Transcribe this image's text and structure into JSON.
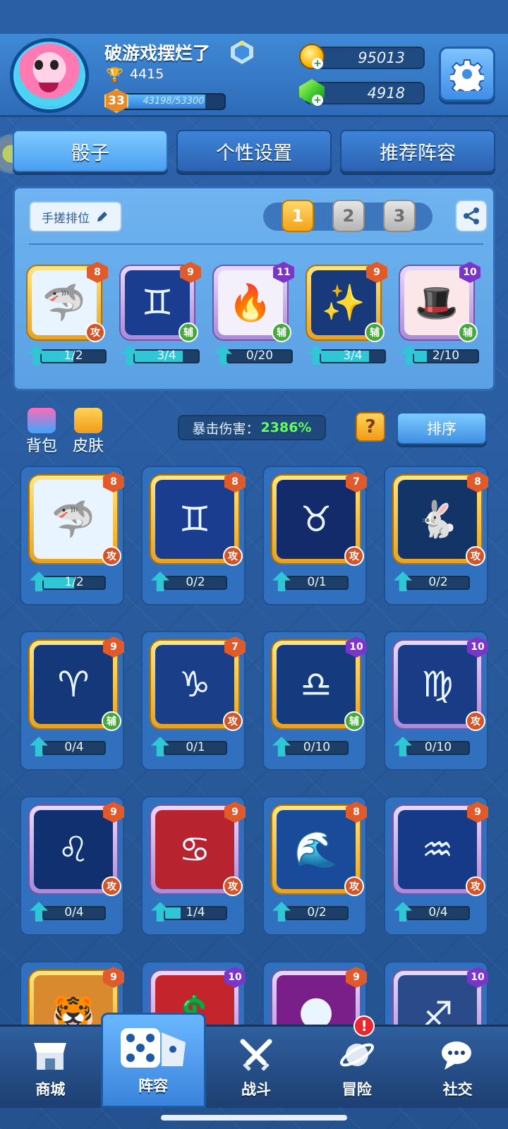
{
  "player": {
    "name": "破游戏摆烂了",
    "trophies": "4415",
    "level": "33",
    "xp": "43198/53300",
    "xp_fraction": 0.81
  },
  "currency": {
    "gold": "95013",
    "gems": "4918"
  },
  "tabs": [
    {
      "label": "骰子"
    },
    {
      "label": "个性设置"
    },
    {
      "label": "推荐阵容"
    }
  ],
  "deck": {
    "manual_label": "手搓排位",
    "slots": [
      "1",
      "2",
      "3"
    ],
    "cards": [
      {
        "level": "8",
        "role": "攻",
        "progress": "1/2",
        "p": 0.5,
        "frame": "gold",
        "art": "shark"
      },
      {
        "level": "9",
        "role": "辅",
        "progress": "3/4",
        "p": 0.75,
        "frame": "purple",
        "art": "gemini"
      },
      {
        "level": "11",
        "role": "辅",
        "progress": "0/20",
        "p": 0.0,
        "frame": "purple",
        "art": "flame"
      },
      {
        "level": "9",
        "role": "辅",
        "progress": "3/4",
        "p": 0.75,
        "frame": "gold",
        "art": "firework"
      },
      {
        "level": "10",
        "role": "辅",
        "progress": "2/10",
        "p": 0.2,
        "frame": "purple",
        "art": "hat"
      }
    ]
  },
  "toolbar": {
    "bag": "背包",
    "skin": "皮肤",
    "crit_label": "暴击伤害：",
    "crit_value": "2386%",
    "help": "?",
    "sort": "排序"
  },
  "dice": [
    {
      "level": "8",
      "role": "攻",
      "progress": "1/2",
      "p": 0.5,
      "frame": "gold",
      "art": "shark"
    },
    {
      "level": "8",
      "role": "攻",
      "progress": "0/2",
      "p": 0.0,
      "frame": "gold",
      "art": "gemini"
    },
    {
      "level": "7",
      "role": "攻",
      "progress": "0/1",
      "p": 0.0,
      "frame": "gold",
      "art": "ox"
    },
    {
      "level": "8",
      "role": "攻",
      "progress": "0/2",
      "p": 0.0,
      "frame": "gold",
      "art": "rabbit"
    },
    {
      "level": "9",
      "role": "辅",
      "progress": "0/4",
      "p": 0.0,
      "frame": "gold",
      "art": "aries"
    },
    {
      "level": "7",
      "role": "攻",
      "progress": "0/1",
      "p": 0.0,
      "frame": "gold",
      "art": "capricorn"
    },
    {
      "level": "10",
      "role": "辅",
      "progress": "0/10",
      "p": 0.0,
      "frame": "gold",
      "art": "libra"
    },
    {
      "level": "10",
      "role": "攻",
      "progress": "0/10",
      "p": 0.0,
      "frame": "purple",
      "art": "virgo"
    },
    {
      "level": "9",
      "role": "攻",
      "progress": "0/4",
      "p": 0.0,
      "frame": "purple",
      "art": "leo"
    },
    {
      "level": "9",
      "role": "攻",
      "progress": "1/4",
      "p": 0.25,
      "frame": "purple",
      "art": "cancer"
    },
    {
      "level": "8",
      "role": "攻",
      "progress": "0/2",
      "p": 0.0,
      "frame": "gold",
      "art": "wave"
    },
    {
      "level": "9",
      "role": "攻",
      "progress": "0/4",
      "p": 0.0,
      "frame": "purple",
      "art": "aquarius"
    },
    {
      "level": "9",
      "role": "",
      "progress": "",
      "p": 0.0,
      "frame": "gold",
      "art": "tiger"
    },
    {
      "level": "10",
      "role": "",
      "progress": "",
      "p": 0.0,
      "frame": "purple",
      "art": "dollar"
    },
    {
      "level": "9",
      "role": "",
      "progress": "",
      "p": 0.0,
      "frame": "purple",
      "art": "moon"
    },
    {
      "level": "10",
      "role": "",
      "progress": "",
      "p": 0.0,
      "frame": "purple",
      "art": "archer"
    }
  ],
  "nav": [
    {
      "label": "商城",
      "icon": "shop-icon"
    },
    {
      "label": "阵容",
      "icon": "dice-icon"
    },
    {
      "label": "战斗",
      "icon": "swords-icon"
    },
    {
      "label": "冒险",
      "icon": "planet-icon",
      "badge": "!"
    },
    {
      "label": "社交",
      "icon": "chat-icon"
    }
  ]
}
